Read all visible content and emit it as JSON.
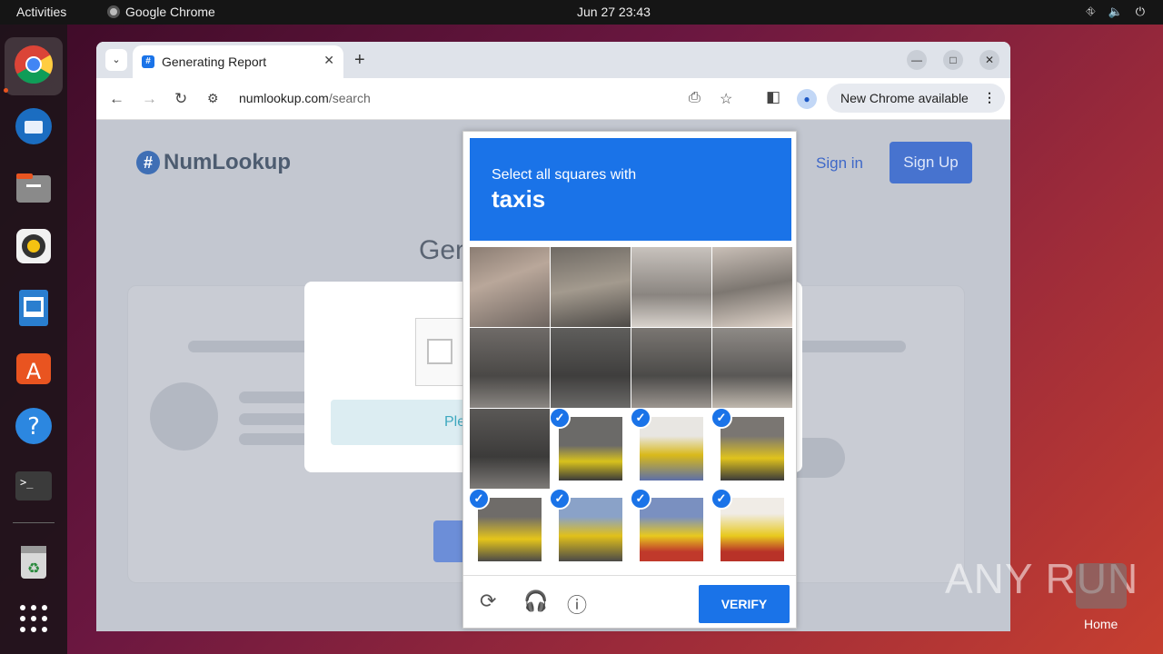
{
  "topbar": {
    "activities": "Activities",
    "app_name": "Google Chrome",
    "clock": "Jun 27  23:43"
  },
  "dock": {
    "icons": [
      "chrome-icon",
      "thunderbird-icon",
      "files-icon",
      "rhythmbox-icon",
      "writer-icon",
      "appcenter-icon",
      "help-icon",
      "terminal-icon",
      "trash-icon",
      "apps-grid-icon"
    ]
  },
  "browser": {
    "tab_title": "Generating Report",
    "url_host": "numlookup.com",
    "url_path": "/search",
    "update_label": "New Chrome available"
  },
  "site": {
    "logo": "NumLookup",
    "signin": "Sign in",
    "signup": "Sign Up",
    "heading_partial": "Gen",
    "please_partial": "Ple"
  },
  "captcha": {
    "instruction": "Select all squares with",
    "target": "taxis",
    "verify_label": "VERIFY",
    "tiles_selected": [
      false,
      false,
      false,
      false,
      false,
      false,
      false,
      false,
      false,
      true,
      true,
      true,
      true,
      true,
      true,
      true
    ]
  },
  "desktop": {
    "watermark": "ANY RUN",
    "home_label": "Home"
  }
}
